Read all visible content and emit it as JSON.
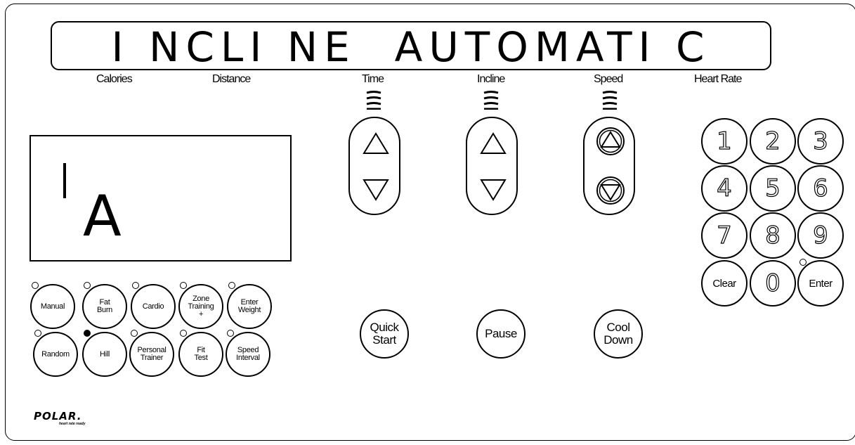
{
  "display": {
    "banner_text": "I NCLI NE  AUTOMATI C",
    "lcd_char_small": "I",
    "lcd_char_big": "A"
  },
  "labels": {
    "calories": "Calories",
    "distance": "Distance",
    "time": "Time",
    "incline": "Incline",
    "speed": "Speed",
    "heart_rate": "Heart Rate"
  },
  "controls": {
    "time": {
      "up_icon": "triangle-up-icon",
      "down_icon": "triangle-down-icon"
    },
    "incline": {
      "up_icon": "triangle-up-icon",
      "down_icon": "triangle-down-icon"
    },
    "speed": {
      "up_icon": "circled-triangle-up-icon",
      "down_icon": "circled-triangle-down-icon"
    }
  },
  "programs": {
    "row1": [
      {
        "label": "Manual",
        "led_on": false
      },
      {
        "label": "Fat Burn",
        "led_on": false
      },
      {
        "label": "Cardio",
        "led_on": false
      },
      {
        "label": "Zone Training +",
        "led_on": false
      },
      {
        "label": "Enter Weight",
        "led_on": false
      }
    ],
    "row2": [
      {
        "label": "Random",
        "led_on": false
      },
      {
        "label": "Hill",
        "led_on": true
      },
      {
        "label": "Personal Trainer",
        "led_on": false
      },
      {
        "label": "Fit Test",
        "led_on": false
      },
      {
        "label": "Speed Interval",
        "led_on": false
      }
    ]
  },
  "actions": {
    "quick_start": "Quick Start",
    "pause": "Pause",
    "cool_down": "Cool Down"
  },
  "keypad": {
    "k1": "1",
    "k2": "2",
    "k3": "3",
    "k4": "4",
    "k5": "5",
    "k6": "6",
    "k7": "7",
    "k8": "8",
    "k9": "9",
    "clear": "Clear",
    "k0": "0",
    "enter": "Enter"
  },
  "brand": {
    "logo": "POLAR.",
    "tagline": "heart rate ready"
  }
}
